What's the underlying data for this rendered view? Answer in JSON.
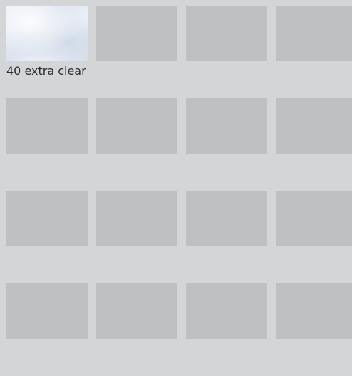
{
  "gallery": {
    "items": [
      {
        "caption": "40 extra clear",
        "has_image": true
      },
      {
        "caption": "",
        "has_image": false
      },
      {
        "caption": "",
        "has_image": false
      },
      {
        "caption": "",
        "has_image": false
      },
      {
        "caption": "",
        "has_image": false
      },
      {
        "caption": "",
        "has_image": false
      },
      {
        "caption": "",
        "has_image": false
      },
      {
        "caption": "",
        "has_image": false
      },
      {
        "caption": "",
        "has_image": false
      },
      {
        "caption": "",
        "has_image": false
      },
      {
        "caption": "",
        "has_image": false
      },
      {
        "caption": "",
        "has_image": false
      },
      {
        "caption": "",
        "has_image": false
      },
      {
        "caption": "",
        "has_image": false
      },
      {
        "caption": "",
        "has_image": false
      },
      {
        "caption": "",
        "has_image": false
      }
    ]
  }
}
